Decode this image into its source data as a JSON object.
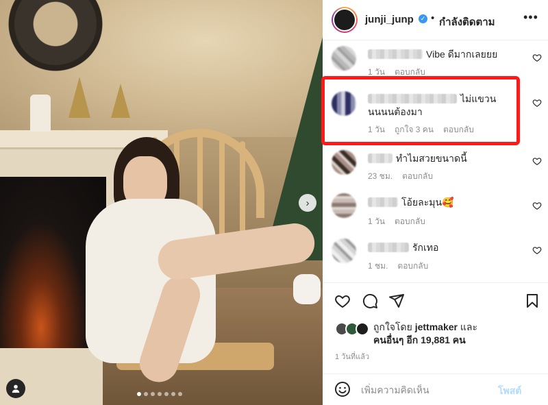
{
  "post": {
    "carousel_dots": 7,
    "active_dot": 0
  },
  "header": {
    "username": "junji_junp",
    "separator": "•",
    "follow_status": "กำลังติดตาม",
    "more": "•••"
  },
  "comments": [
    {
      "text": "Vibe ดีมากเลยยย",
      "time": "1 วัน",
      "likes": "",
      "reply": "ตอบกลับ"
    },
    {
      "text": "ไม่แขวนนนนนต้องมา",
      "time": "1 วัน",
      "likes": "ถูกใจ 3 คน",
      "reply": "ตอบกลับ"
    },
    {
      "text": "ทำไมสวยขนาดนี้",
      "time": "23 ชม.",
      "likes": "",
      "reply": "ตอบกลับ"
    },
    {
      "text": "โอ้ยละมุน🥰",
      "time": "1 วัน",
      "likes": "",
      "reply": "ตอบกลับ"
    },
    {
      "text": "รักเทอ",
      "time": "1 ชม.",
      "likes": "",
      "reply": "ตอบกลับ"
    }
  ],
  "likes": {
    "prefix": "ถูกใจโดย",
    "user": "jettmaker",
    "and": "และ",
    "others": "คนอื่นๆ อีก 19,881 คน"
  },
  "timestamp": "1 วันที่แล้ว",
  "add_comment": {
    "placeholder": "เพิ่มความคิดเห็น",
    "post_label": "โพสต์"
  },
  "colors": {
    "highlight": "#ff1a1a",
    "verified": "#3897f0",
    "post_disabled": "#b3dbff"
  }
}
